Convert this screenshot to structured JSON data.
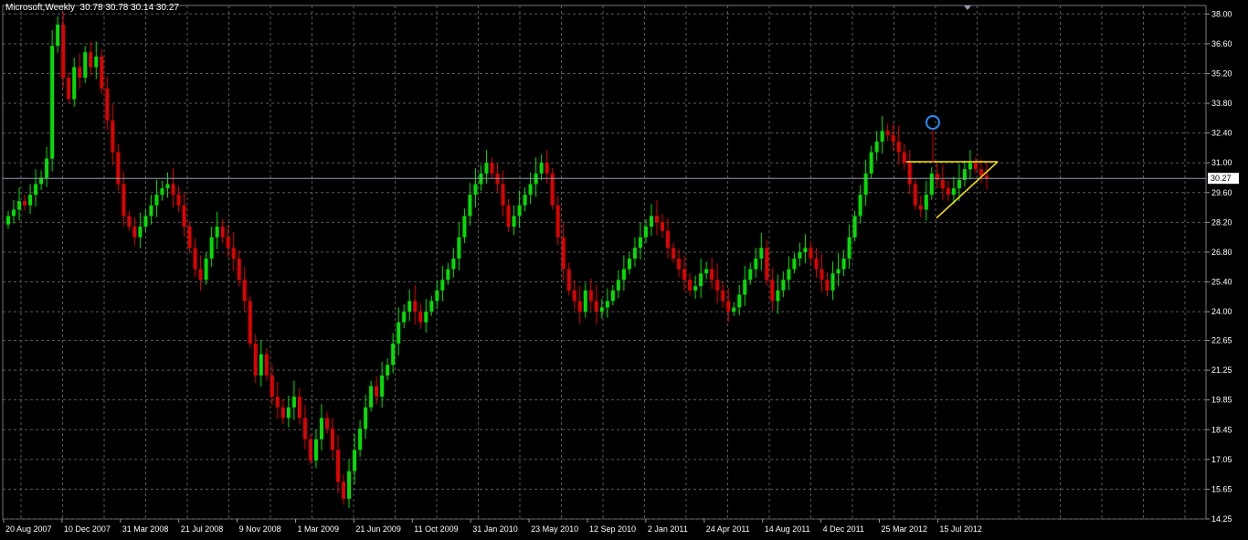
{
  "window": {
    "symbol_label": "Microsoft,Weekly",
    "ohlc": "30.78 30.78 30.14 30.27"
  },
  "colors": {
    "background": "#000000",
    "grid": "#5a5a5a",
    "axis_text": "#ffffff",
    "bull": "#00e000",
    "bear": "#e00000",
    "triangle": "#ffea00",
    "marker_circle": "#1e90ff",
    "current_line": "#8aa0b4"
  },
  "chart_data": {
    "type": "candlestick",
    "title": "Microsoft,Weekly",
    "ylim": [
      14.25,
      38.4
    ],
    "y_ticks": [
      "38.00",
      "36.60",
      "35.20",
      "33.80",
      "32.40",
      "31.00",
      "29.60",
      "28.20",
      "26.80",
      "25.40",
      "24.00",
      "22.65",
      "21.25",
      "19.85",
      "18.45",
      "17.05",
      "15.65",
      "14.25"
    ],
    "x_ticks": [
      "20 Aug 2007",
      "10 Dec 2007",
      "31 Mar 2008",
      "21 Jul 2008",
      "9 Nov 2008",
      "1 Mar 2009",
      "21 Jun 2009",
      "11 Oct 2009",
      "31 Jan 2010",
      "23 May 2010",
      "12 Sep 2010",
      "2 Jan 2011",
      "24 Apr 2011",
      "14 Aug 2011",
      "4 Dec 2011",
      "25 Mar 2012",
      "15 Jul 2012"
    ],
    "current_price": 30.27,
    "current_price_label": "30.27",
    "closes": [
      28.5,
      28.8,
      29.2,
      29.0,
      29.5,
      30.0,
      30.3,
      31.2,
      36.5,
      37.5,
      35.0,
      34.0,
      35.5,
      35.0,
      36.2,
      35.5,
      36.0,
      34.5,
      33.0,
      31.5,
      30.0,
      28.5,
      28.0,
      27.5,
      28.0,
      28.5,
      29.0,
      29.5,
      29.8,
      30.0,
      29.5,
      29.0,
      28.0,
      27.0,
      26.0,
      25.5,
      26.5,
      27.5,
      28.0,
      27.5,
      27.0,
      26.5,
      25.5,
      24.5,
      22.5,
      21.0,
      22.0,
      21.0,
      20.0,
      19.5,
      19.0,
      19.5,
      20.0,
      19.0,
      18.0,
      17.0,
      18.0,
      19.0,
      18.5,
      17.5,
      16.0,
      15.2,
      16.5,
      17.5,
      18.5,
      19.5,
      20.5,
      20.0,
      21.0,
      21.5,
      22.5,
      23.5,
      24.0,
      24.5,
      24.0,
      23.5,
      24.0,
      24.5,
      25.0,
      25.5,
      26.0,
      26.5,
      27.5,
      28.5,
      29.5,
      30.0,
      30.5,
      31.0,
      30.5,
      30.0,
      29.0,
      28.0,
      28.5,
      29.0,
      29.5,
      30.0,
      30.5,
      31.0,
      30.5,
      29.0,
      27.5,
      26.0,
      25.0,
      24.5,
      24.0,
      25.0,
      24.5,
      24.0,
      24.2,
      24.5,
      25.0,
      25.5,
      26.0,
      26.5,
      27.0,
      27.5,
      28.0,
      28.5,
      28.2,
      27.8,
      27.0,
      26.5,
      26.0,
      25.5,
      25.0,
      25.2,
      25.8,
      26.0,
      25.5,
      25.0,
      24.5,
      24.0,
      24.2,
      24.8,
      25.5,
      26.0,
      26.5,
      27.0,
      25.5,
      24.5,
      25.0,
      25.5,
      26.0,
      26.5,
      26.8,
      27.0,
      26.5,
      26.0,
      25.5,
      25.0,
      25.8,
      26.0,
      26.5,
      27.5,
      28.5,
      29.5,
      30.5,
      31.5,
      32.0,
      32.5,
      32.3,
      32.0,
      31.5,
      31.0,
      30.0,
      29.0,
      28.8,
      29.5,
      30.5,
      30.2,
      29.8,
      29.5,
      29.8,
      30.2,
      30.7,
      31.0,
      30.7,
      30.4,
      30.27
    ],
    "triangle": {
      "upper": [
        [
          29.2,
          31.05
        ],
        [
          32.5,
          31.05
        ]
      ],
      "lower": [
        [
          29.2,
          28.4
        ],
        [
          32.5,
          31.05
        ]
      ]
    },
    "marker_price": 32.9
  }
}
